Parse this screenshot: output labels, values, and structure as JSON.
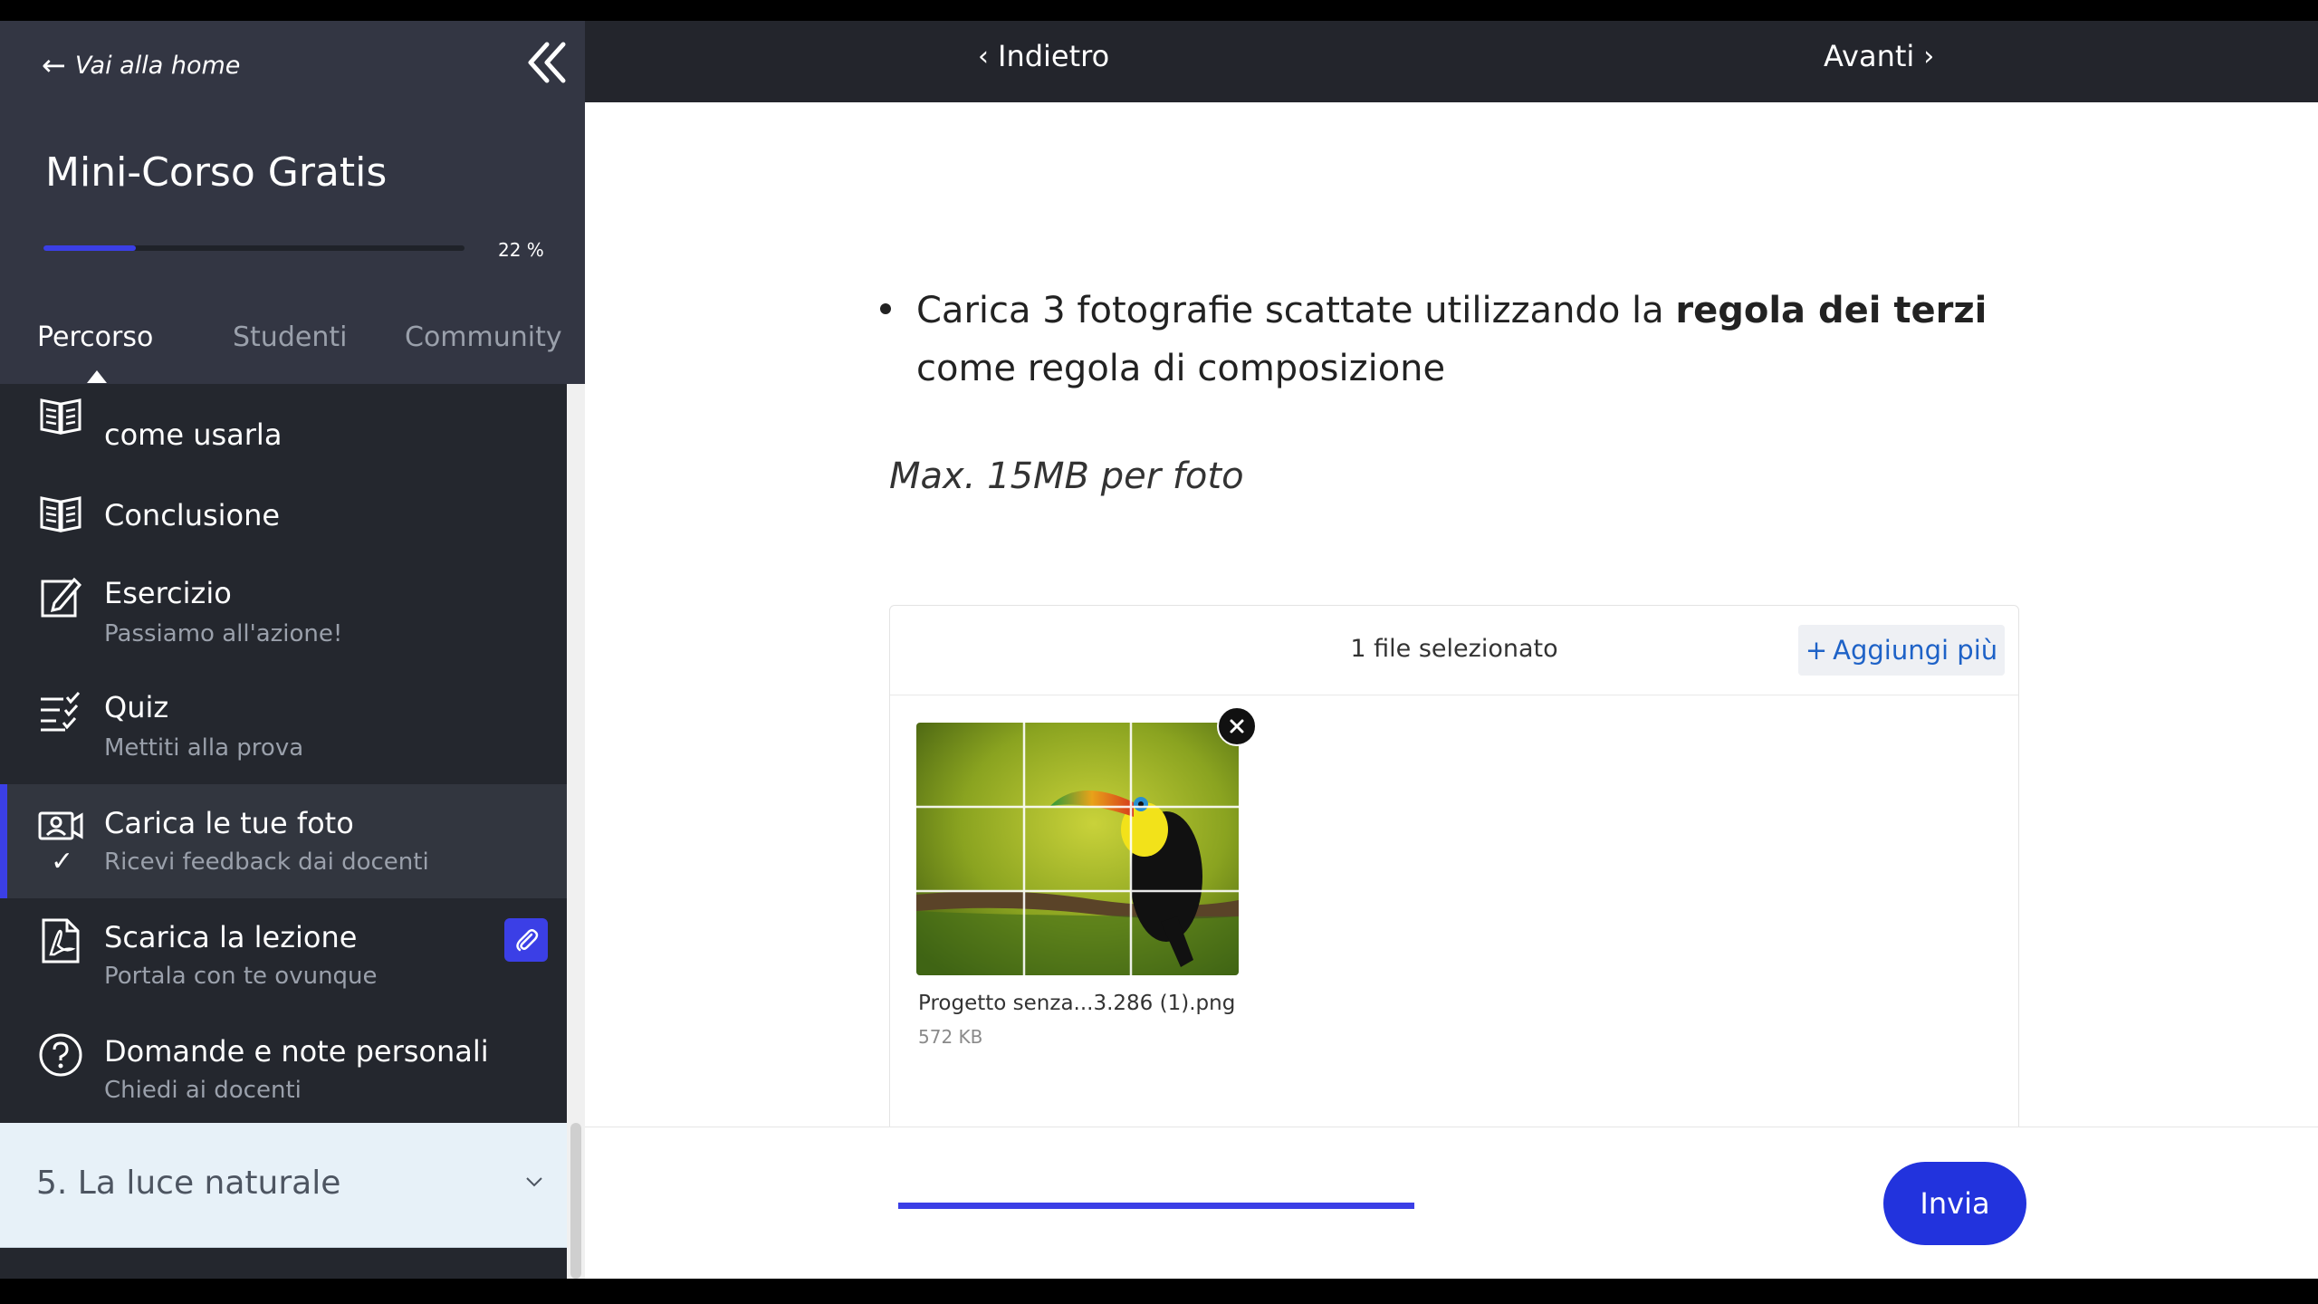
{
  "sidebar": {
    "home_link": "Vai alla home",
    "course_title": "Mini-Corso Gratis",
    "progress_value": 22,
    "progress_label": "22 %",
    "tabs": [
      "Percorso",
      "Studenti",
      "Community"
    ],
    "items": [
      {
        "title": "come usarla",
        "icon": "book-icon"
      },
      {
        "title": "Conclusione",
        "icon": "book-icon"
      },
      {
        "title": "Esercizio",
        "subtitle": "Passiamo all'azione!",
        "icon": "pencil-square-icon"
      },
      {
        "title": "Quiz",
        "subtitle": "Mettiti alla prova",
        "icon": "checklist-icon"
      },
      {
        "title": "Carica le tue foto",
        "subtitle": "Ricevi feedback dai docenti",
        "icon": "camera-upload-icon",
        "status": "✓"
      },
      {
        "title": "Scarica la lezione",
        "subtitle": "Portala con te ovunque",
        "icon": "pdf-icon"
      },
      {
        "title": "Domande e note personali",
        "subtitle": "Chiedi ai docenti",
        "icon": "question-circle-icon"
      }
    ],
    "section": {
      "label": "5. La luce naturale"
    }
  },
  "topbar": {
    "prev_label": "Indietro",
    "next_label": "Avanti"
  },
  "content": {
    "instruction_pre": "Carica 3 fotografie scattate utilizzando la ",
    "instruction_bold": "regola dei terzi",
    "instruction_post": " come regola di composizione",
    "note": "Max. 15MB per foto"
  },
  "uploader": {
    "selected_count": "1 file selezionato",
    "add_more_label": "Aggiungi più",
    "file": {
      "name": "Progetto senza...3.286 (1).png",
      "size": "572 KB"
    }
  },
  "footer": {
    "submit_label": "Invia"
  },
  "colors": {
    "accent": "#3b3fe6",
    "sidebar_bg": "#24272e",
    "link": "#1e62c7"
  }
}
